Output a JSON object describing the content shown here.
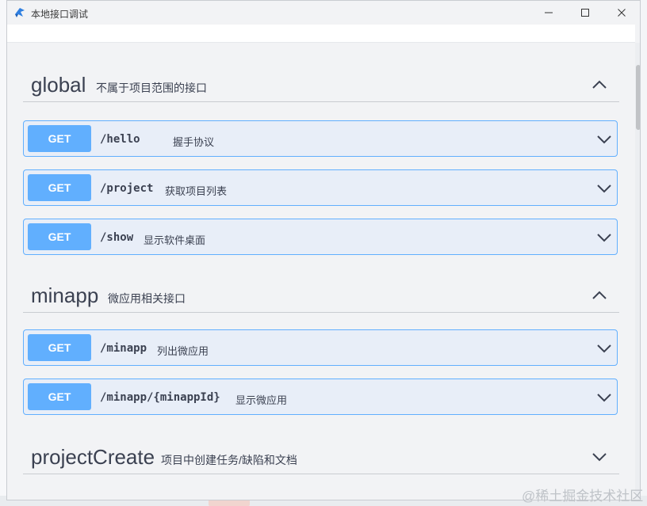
{
  "window": {
    "title": "本地接口调试"
  },
  "sections": [
    {
      "name": "global",
      "description": "不属于项目范围的接口",
      "expanded": true,
      "operations": [
        {
          "method": "GET",
          "path": "/hello",
          "summary": "握手协议"
        },
        {
          "method": "GET",
          "path": "/project",
          "summary": "获取项目列表"
        },
        {
          "method": "GET",
          "path": "/show",
          "summary": "显示软件桌面"
        }
      ]
    },
    {
      "name": "minapp",
      "description": "微应用相关接口",
      "expanded": true,
      "operations": [
        {
          "method": "GET",
          "path": "/minapp",
          "summary": "列出微应用"
        },
        {
          "method": "GET",
          "path": "/minapp/{minappId}",
          "summary": "显示微应用"
        }
      ]
    },
    {
      "name": "projectCreate",
      "description": "项目中创建任务/缺陷和文档",
      "expanded": false,
      "operations": []
    }
  ],
  "watermark": "@稀土掘金技术社区",
  "colors": {
    "get_accent": "#61affe",
    "op_background": "#e8eef8",
    "text": "#3b4151"
  },
  "icons": [
    "app-icon",
    "minimize-icon",
    "maximize-icon",
    "close-icon",
    "chevron-up-icon",
    "chevron-down-icon"
  ]
}
